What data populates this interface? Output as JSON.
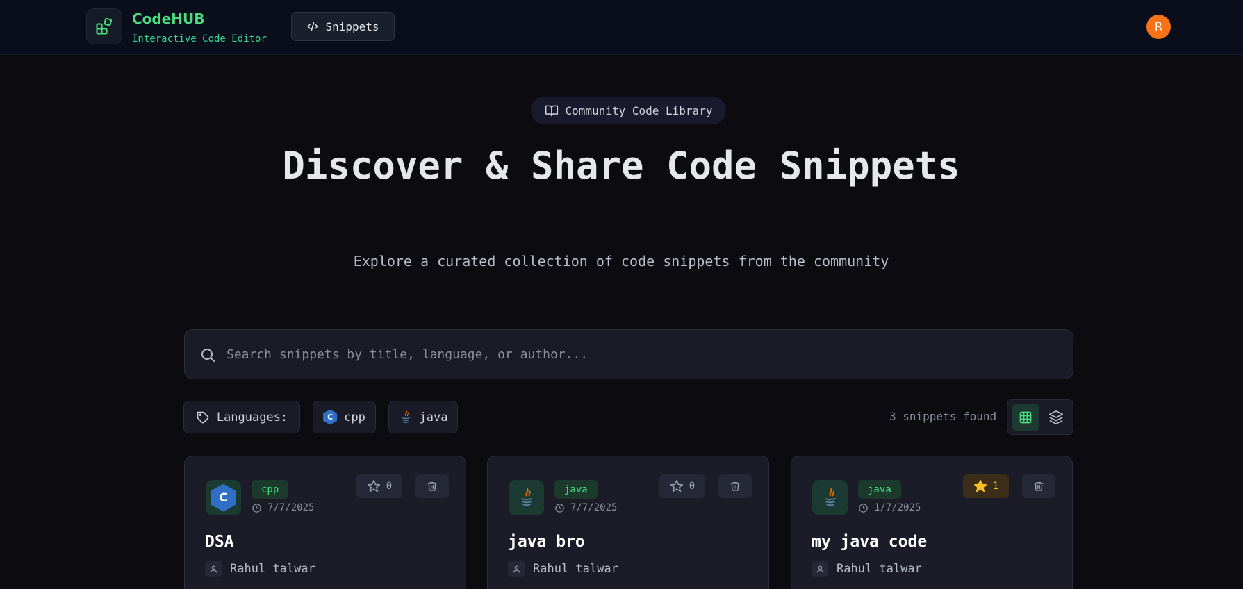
{
  "header": {
    "brand_title": "CodeHUB",
    "brand_subtitle": "Interactive Code Editor",
    "nav_snippets": "Snippets",
    "avatar_initial": "R"
  },
  "hero": {
    "badge": "Community Code Library",
    "title": "Discover & Share Code Snippets",
    "subtitle": "Explore a curated collection of code snippets from the community"
  },
  "search": {
    "placeholder": "Search snippets by title, language, or author...",
    "value": ""
  },
  "filters": {
    "languages_label": "Languages:",
    "languages": [
      "cpp",
      "java"
    ]
  },
  "results": {
    "count_text": "3 snippets found",
    "active_view": "grid"
  },
  "snippets": [
    {
      "language": "cpp",
      "date": "7/7/2025",
      "stars": "0",
      "starred": false,
      "title": "DSA",
      "author": "Rahul talwar",
      "icon": "cpp-logo-icon"
    },
    {
      "language": "java",
      "date": "7/7/2025",
      "stars": "0",
      "starred": false,
      "title": "java bro",
      "author": "Rahul talwar",
      "icon": "java-logo-icon"
    },
    {
      "language": "java",
      "date": "1/7/2025",
      "stars": "1",
      "starred": true,
      "title": "my java code",
      "author": "Rahul talwar",
      "icon": "java-logo-icon"
    }
  ],
  "colors": {
    "accent": "#4ade80",
    "avatar": "#f97316",
    "star_active": "#fbbf24",
    "background": "#0b0b10"
  }
}
